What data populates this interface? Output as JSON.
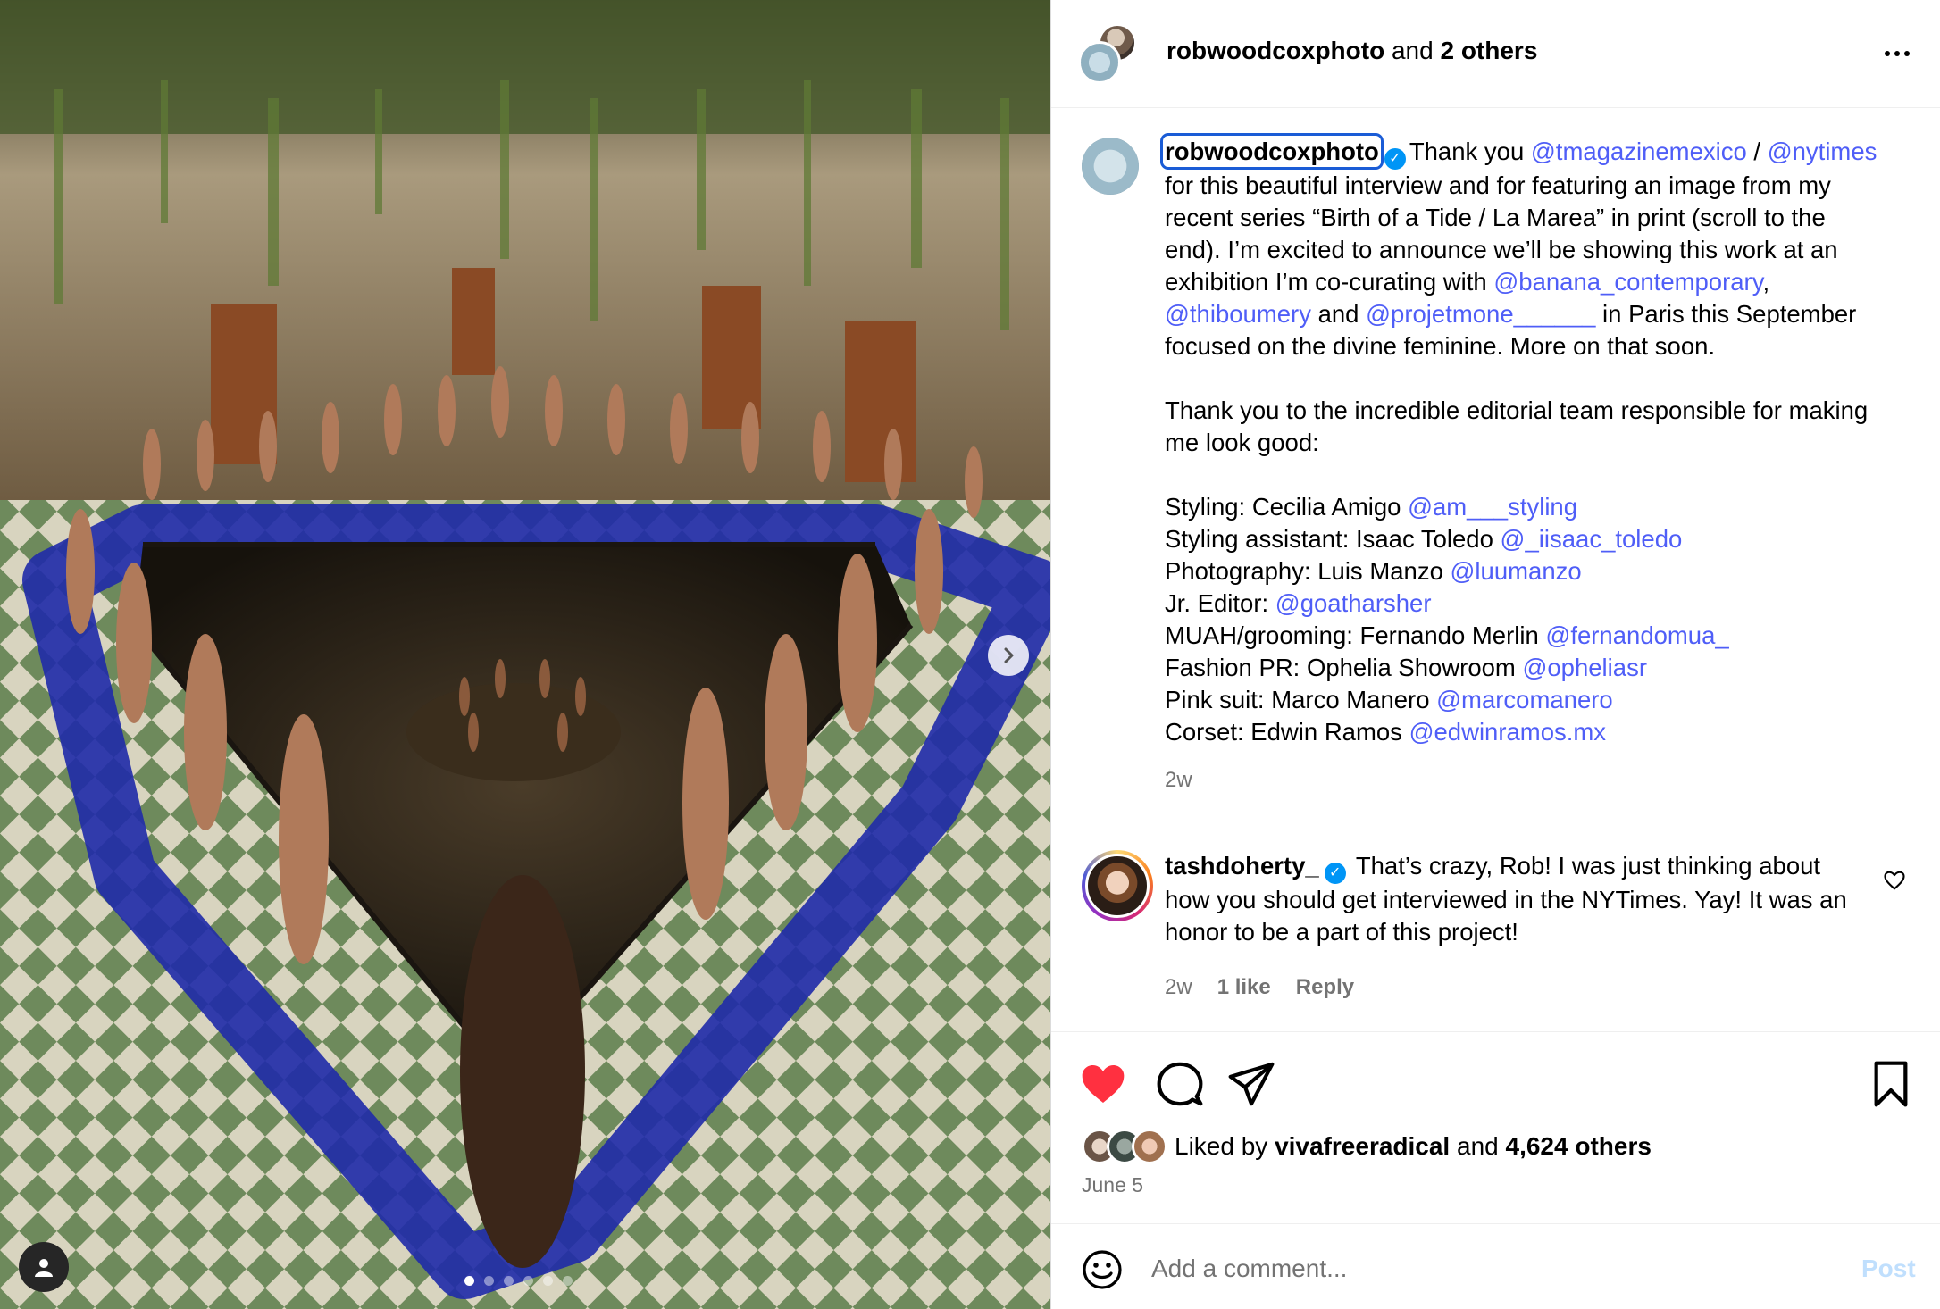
{
  "header": {
    "username": "robwoodcoxphoto",
    "joiner": " and ",
    "others": "2 others"
  },
  "caption": {
    "username": "robwoodcoxphoto",
    "p1a": "Thank you ",
    "m_tmag": "@tmagazinemexico",
    "p1b": " / ",
    "m_nyt": "@nytimes",
    "p1c": " for this beautiful interview and for featuring an image from my recent series “Birth of a Tide / La Marea” in print (scroll to the end). I’m excited to announce we’ll be showing this work at an exhibition I’m co-curating with ",
    "m_banana": "@banana_contemporary",
    "p1d": ", ",
    "m_thibo": "@thiboumery",
    "p1e": " and ",
    "m_projet": "@projetmone______",
    "p1f": " in Paris this September focused on the divine feminine. More on that soon.",
    "p2": "Thank you to the incredible editorial team responsible for making me look good:",
    "credits": [
      {
        "label": "Styling: Cecilia Amigo ",
        "handle": "@am___styling"
      },
      {
        "label": "Styling assistant: Isaac Toledo ",
        "handle": "@_iisaac_toledo"
      },
      {
        "label": "Photography: Luis Manzo ",
        "handle": "@luumanzo"
      },
      {
        "label": "Jr. Editor: ",
        "handle": "@goatharsher"
      },
      {
        "label": "MUAH/grooming: Fernando Merlin ",
        "handle": "@fernandomua_"
      },
      {
        "label": "Fashion PR: Ophelia Showroom ",
        "handle": "@opheliasr"
      },
      {
        "label": "Pink suit: Marco Manero ",
        "handle": "@marcomanero"
      },
      {
        "label": "Corset: Edwin Ramos ",
        "handle": "@edwinramos.mx"
      }
    ],
    "time": "2w"
  },
  "comment": {
    "username": "tashdoherty_",
    "text": "That’s crazy, Rob! I was just thinking about how you should get interviewed in the NYTimes. Yay! It was an honor to be a part of this project!",
    "time": "2w",
    "likes": "1 like",
    "reply": "Reply"
  },
  "actions": {
    "liked_by_prefix": "Liked by ",
    "liked_by_user": "vivafreeradical",
    "liked_by_join": " and ",
    "liked_by_count": "4,624 others",
    "date": "June 5"
  },
  "add_comment": {
    "placeholder": "Add a comment...",
    "post": "Post"
  },
  "carousel": {
    "slide_count": 6,
    "active_index": 0
  },
  "icons": {
    "like": "heart-filled-icon",
    "comment": "comment-icon",
    "share": "share-icon",
    "save": "bookmark-icon",
    "more": "more-icon",
    "next": "chevron-right-icon",
    "tag": "user-tag-icon",
    "emoji": "emoji-icon"
  },
  "colors": {
    "link": "#4f5ef7",
    "like_red": "#ff3040",
    "verified": "#0095f6",
    "post_disabled": "#c0dffd",
    "muted": "#737373"
  }
}
